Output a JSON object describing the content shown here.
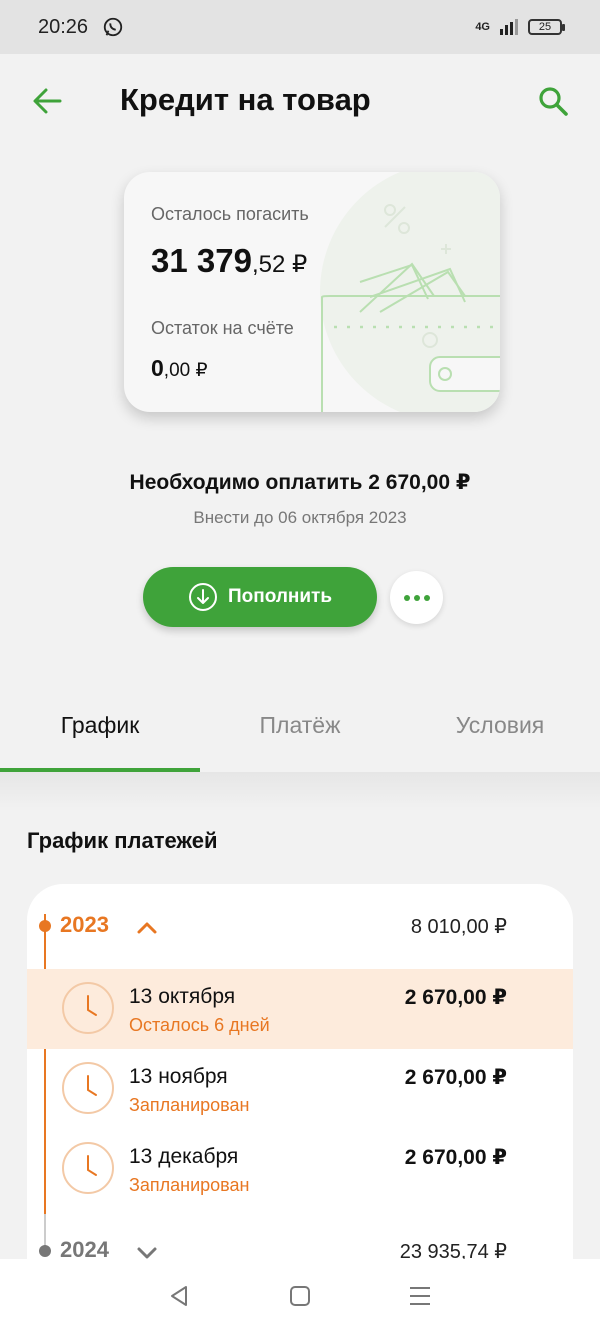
{
  "status": {
    "time": "20:26",
    "network": "4G",
    "battery": "25"
  },
  "header": {
    "title": "Кредит на товар"
  },
  "card": {
    "remaining_label": "Осталось погасить",
    "remaining_int": "31 379",
    "remaining_kop": ",52 ₽",
    "account_label": "Остаток на счёте",
    "account_int": "0",
    "account_kop": ",00 ₽"
  },
  "due": {
    "title": "Необходимо оплатить 2 670,00 ₽",
    "subtitle": "Внести до 06 октября 2023"
  },
  "actions": {
    "topup_label": "Пополнить"
  },
  "tabs": [
    {
      "label": "График",
      "active": true
    },
    {
      "label": "Платёж",
      "active": false
    },
    {
      "label": "Условия",
      "active": false
    }
  ],
  "schedule": {
    "title": "График платежей",
    "years": [
      {
        "year": "2023",
        "total": "8 010,00 ₽",
        "expanded": true,
        "payments": [
          {
            "date": "13 октября",
            "status": "Осталось 6 дней",
            "amount": "2 670,00 ₽",
            "current": true
          },
          {
            "date": "13 ноября",
            "status": "Запланирован",
            "amount": "2 670,00 ₽",
            "current": false
          },
          {
            "date": "13 декабря",
            "status": "Запланирован",
            "amount": "2 670,00 ₽",
            "current": false
          }
        ]
      },
      {
        "year": "2024",
        "total": "23 935,74 ₽",
        "expanded": false
      }
    ]
  },
  "colors": {
    "accent_green": "#3fa33a",
    "accent_orange": "#e87722"
  }
}
